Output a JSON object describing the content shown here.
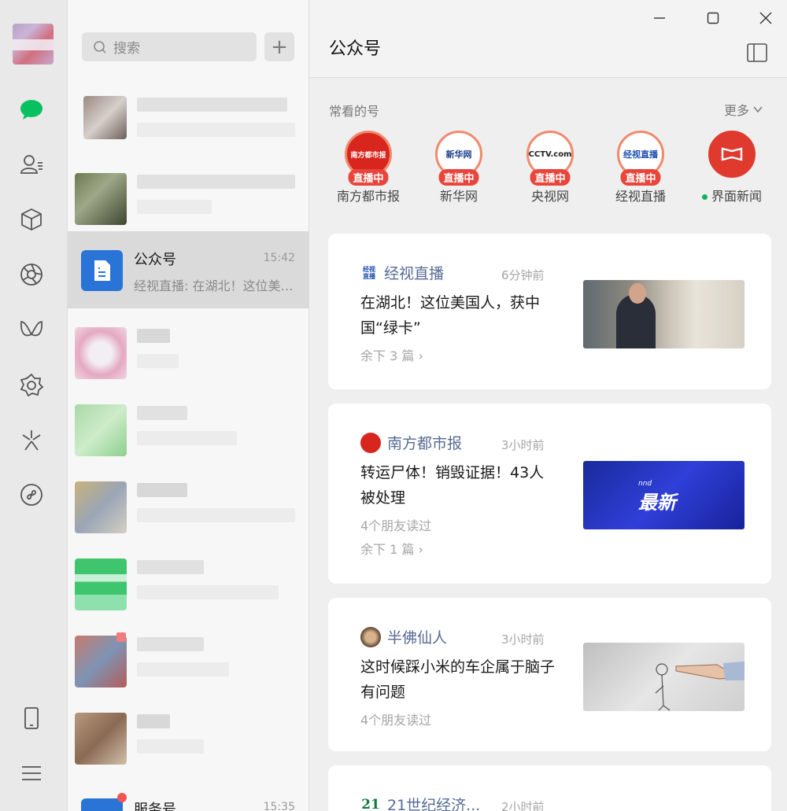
{
  "window": {
    "minimize_icon": "minimize-icon",
    "maximize_icon": "maximize-icon",
    "close_icon": "close-icon"
  },
  "search": {
    "placeholder": "搜索",
    "add_label": "+"
  },
  "chats": {
    "official_accounts": {
      "name": "公众号",
      "time": "15:42",
      "preview": "经视直播: 在湖北！这位美国人，获中国“绿卡”"
    },
    "service_accounts": {
      "name": "服务号",
      "time": "15:35"
    }
  },
  "main": {
    "title": "公众号",
    "frequent_label": "常看的号",
    "more_label": "更多",
    "live_label": "直播中",
    "favorites": [
      {
        "name": "南方都市报",
        "logo_text": "南方都市报"
      },
      {
        "name": "新华网",
        "logo_text": "新华网"
      },
      {
        "name": "央视网",
        "logo_text": "CCTV.com"
      },
      {
        "name": "经视直播",
        "logo_text": "经视直播"
      },
      {
        "name": "界面新闻",
        "logo_text": ""
      }
    ],
    "articles": [
      {
        "source": "经视直播",
        "time": "6分钟前",
        "title": "在湖北！这位美国人，获中国“绿卡”",
        "remaining": "余下 3 篇",
        "source_icon_text": "经视直播"
      },
      {
        "source": "南方都市报",
        "time": "3小时前",
        "title": "转运尸体！销毁证据！43人被处理",
        "friends_read": "4个朋友读过",
        "remaining": "余下 1 篇",
        "thumb_small": "nnd",
        "thumb_text": "最新"
      },
      {
        "source": "半佛仙人",
        "time": "3小时前",
        "title": "这时候踩小米的车企属于脑子有问题",
        "friends_read": "4个朋友读过"
      },
      {
        "source": "21世纪经济...",
        "time": "2小时前",
        "source_icon_text": "21"
      }
    ]
  },
  "colors": {
    "accent_green": "#07c160",
    "link_blue": "#576b95",
    "live_red": "#e9453b"
  }
}
